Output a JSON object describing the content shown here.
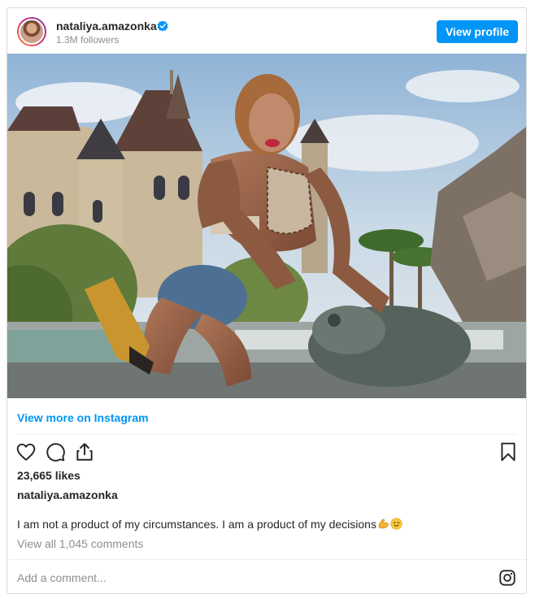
{
  "header": {
    "username": "nataliya.amazonka",
    "followers": "1.3M followers",
    "view_profile_label": "View profile"
  },
  "post": {
    "view_more_label": "View more on Instagram",
    "likes": "23,665 likes",
    "caption_user": "nataliya.amazonka",
    "caption_text": "I am not a product of my circumstances. I am a product of my decisions",
    "view_comments_label": "View all 1,045 comments",
    "comment_placeholder": "Add a comment..."
  },
  "icons": {
    "verified": "verified-badge-icon",
    "like": "heart-icon",
    "comment": "comment-icon",
    "share": "share-icon",
    "save": "bookmark-icon",
    "instagram": "instagram-icon",
    "caption_emojis": [
      "flexed-biceps-icon",
      "winking-face-icon"
    ]
  },
  "colors": {
    "accent": "#0095f6",
    "text": "#262626",
    "muted": "#8e8e8e",
    "border": "#dbdbdb"
  }
}
